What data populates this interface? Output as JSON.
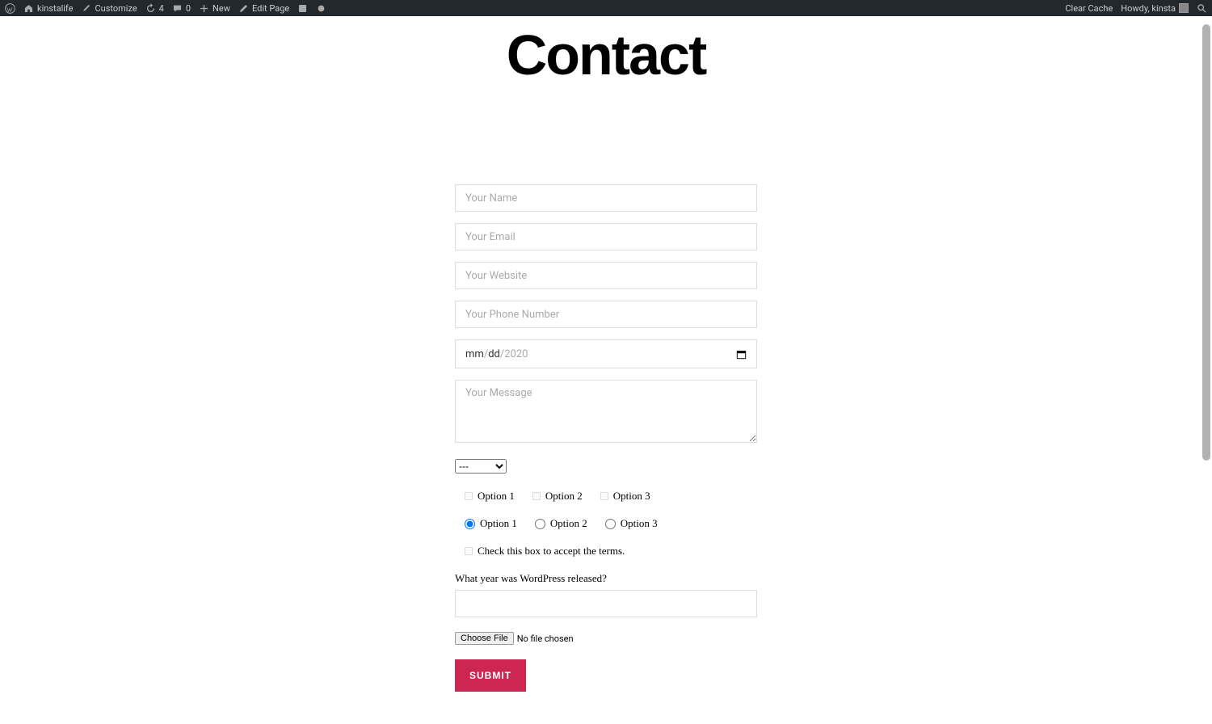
{
  "adminbar": {
    "site_name": "kinstalife",
    "customize": "Customize",
    "updates_count": "4",
    "comments_count": "0",
    "new_label": "New",
    "edit_page": "Edit Page",
    "clear_cache": "Clear Cache",
    "howdy": "Howdy, kinsta"
  },
  "page": {
    "title": "Contact"
  },
  "form": {
    "name_placeholder": "Your Name",
    "email_placeholder": "Your Email",
    "website_placeholder": "Your Website",
    "phone_placeholder": "Your Phone Number",
    "date_value": "mm/dd/2020",
    "message_placeholder": "Your Message",
    "select_default": "---",
    "checkbox_options": [
      "Option 1",
      "Option 2",
      "Option 3"
    ],
    "radio_options": [
      "Option 1",
      "Option 2",
      "Option 3"
    ],
    "radio_selected": 0,
    "terms_label": "Check this box to accept the terms.",
    "quiz_question": "What year was WordPress released?",
    "file_button": "Choose File",
    "file_status": "No file chosen",
    "submit_label": "SUBMIT"
  }
}
